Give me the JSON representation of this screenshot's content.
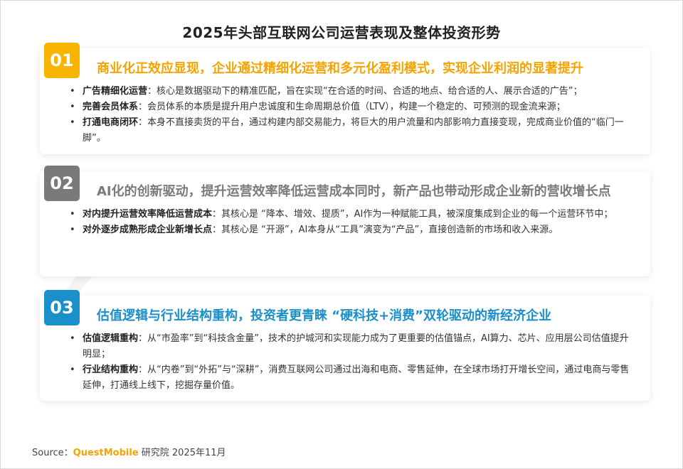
{
  "title": "2025年头部互联网公司运营表现及整体投资形势",
  "colors": {
    "card1": "#f8b400",
    "card2": "#7a7a7a",
    "card3": "#1a8fc9",
    "brand": "#f5a300"
  },
  "cards": [
    {
      "number": "01",
      "headline": "商业化正效应显现，企业通过精细化运营和多元化盈利模式，实现企业利润的显著提升",
      "bullets": [
        {
          "label": "广告精细化运营",
          "text": "：核心是数据驱动下的精准匹配，旨在实现“在合适的时间、合适的地点、给合适的人、展示合适的广告”；"
        },
        {
          "label": "完善会员体系",
          "text": "：会员体系的本质是提升用户忠诚度和生命周期总价值（LTV），构建一个稳定的、可预测的现金流来源；"
        },
        {
          "label": "打通电商闭环",
          "text": "：本身不直接卖货的平台，通过构建内部交易能力，将巨大的用户流量和内部影响力直接变现，完成商业价值的“临门一脚”。"
        }
      ]
    },
    {
      "number": "02",
      "headline": "AI化的创新驱动，提升运营效率降低运营成本同时，新产品也带动形成企业新的营收增长点",
      "bullets": [
        {
          "label": "对内提升运营效率降低运营成本",
          "text": "：其核心是 “降本、增效、提质”，AI作为一种赋能工具，被深度集成到企业的每一个运营环节中；"
        },
        {
          "label": "对外逐步成熟形成企业新增长点",
          "text": "：其核心是 “开源”，AI本身从“工具”演变为“产品”，直接创造新的市场和收入来源。"
        }
      ]
    },
    {
      "number": "03",
      "headline": "估值逻辑与行业结构重构，投资者更青睐 “硬科技+消费”双轮驱动的新经济企业",
      "bullets": [
        {
          "label": "估值逻辑重构",
          "text": "：从“市盈率”到“科技含金量”，技术的护城河和实现能力成为了更重要的估值锚点，AI算力、芯片、应用层公司估值提升明显；"
        },
        {
          "label": "行业结构重构",
          "text": "：从“内卷”到“外拓”与“深耕”，消费互联网公司通过出海和电商、零售延伸，在全球市场打开增长空间，通过电商与零售延伸，打通线上线下，挖掘存量价值。"
        }
      ]
    }
  ],
  "source": {
    "prefix": "Source：",
    "brand": "QuestMobile",
    "suffix": " 研究院 2025年11月"
  }
}
